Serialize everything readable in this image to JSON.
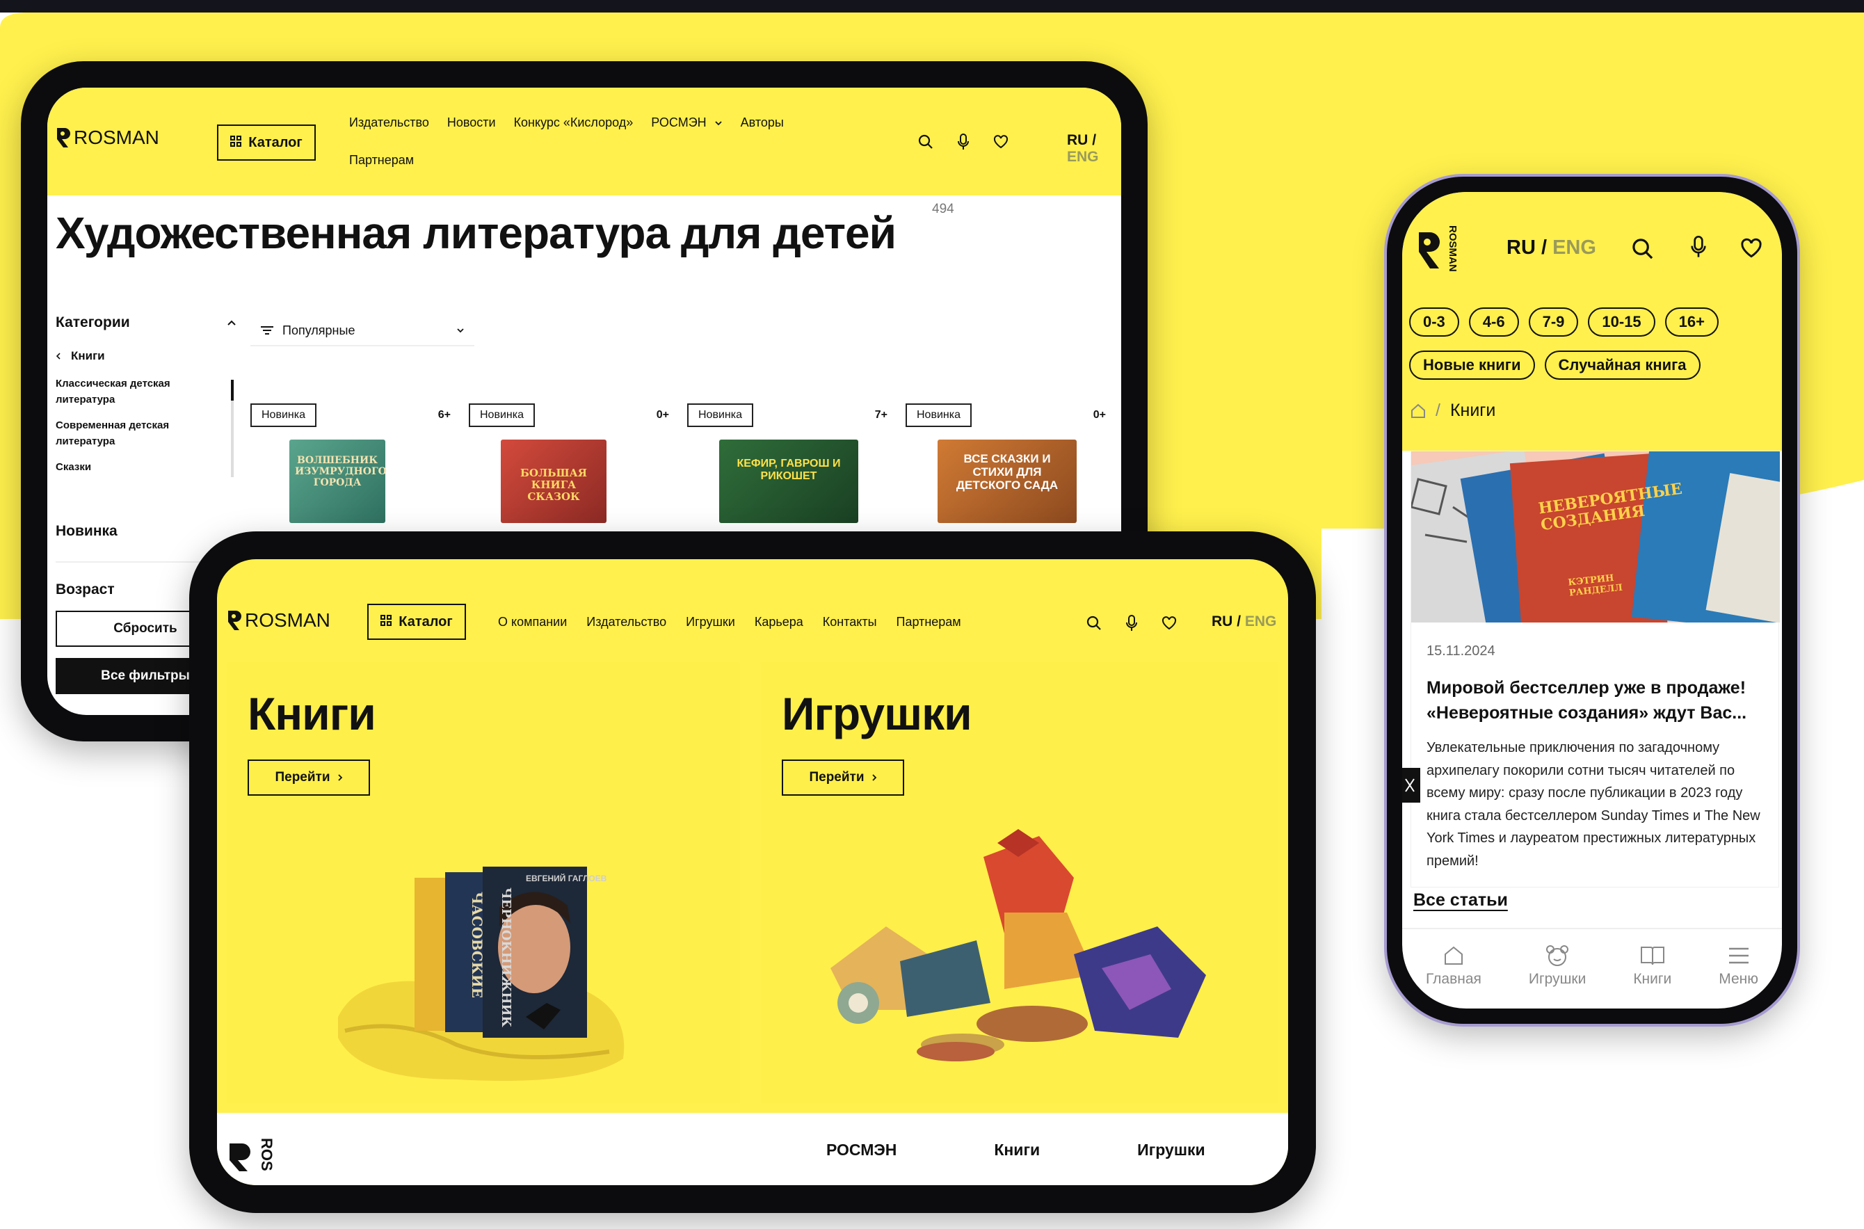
{
  "colors": {
    "accent_yellow": "#fff04d",
    "dark": "#111111",
    "muted_lang": "#9a9a5a"
  },
  "tablet_catalog": {
    "logo_text": "ROSMAN",
    "catalog_button": "Каталог",
    "nav": [
      "Издательство",
      "Новости",
      "Конкурс «Кислород»",
      "РОСМЭН",
      "Авторы",
      "Партнерам"
    ],
    "lang_ru": "RU",
    "lang_sep": "/",
    "lang_eng": "ENG",
    "page_title": "Художественная литература для детей",
    "count": "494",
    "sidebar": {
      "categories_title": "Категории",
      "back_item": "Книги",
      "items": [
        "Классическая детская литература",
        "Современная детская литература",
        "Сказки"
      ],
      "filter_new": "Новинка",
      "filter_age": "Возраст",
      "reset_button": "Сбросить",
      "all_filters_button": "Все фильтры"
    },
    "sort": {
      "selected": "Популярные"
    },
    "products": [
      {
        "badge": "Новинка",
        "age": "6+",
        "cover_text": "ВОЛШЕБНИК ИЗУМРУДНОГО ГОРОДА",
        "cover_color": "#3f8c78"
      },
      {
        "badge": "Новинка",
        "age": "0+",
        "cover_text": "БОЛЬШАЯ КНИГА СКАЗОК",
        "cover_color": "#c23a30"
      },
      {
        "badge": "Новинка",
        "age": "7+",
        "cover_text": "КЕФИР, ГАВРОШ И РИКОШЕТ",
        "cover_color": "#2f6d3a"
      },
      {
        "badge": "Новинка",
        "age": "0+",
        "cover_text": "ВСЕ СКАЗКИ И СТИХИ ДЛЯ ДЕТСКОГО САДА",
        "cover_color": "#c66a2b"
      }
    ]
  },
  "tablet_home": {
    "logo_text": "ROSMAN",
    "catalog_button": "Каталог",
    "nav": [
      "О компании",
      "Издательство",
      "Игрушки",
      "Карьера",
      "Контакты",
      "Партнерам"
    ],
    "lang_ru": "RU",
    "lang_sep": "/",
    "lang_eng": "ENG",
    "tiles": [
      {
        "title": "Книги",
        "button": "Перейти"
      },
      {
        "title": "Игрушки",
        "button": "Перейти"
      }
    ],
    "book_spines": [
      "ЧАСОВСКИЕ",
      "ЧЕРНОКНИЖНИК"
    ],
    "book_cover_author": "ЕВГЕНИЙ ГАГЛОЕВ",
    "footer": {
      "logo_text": "ROS",
      "links": [
        "РОСМЭН",
        "Книги",
        "Игрушки"
      ]
    }
  },
  "phone": {
    "logo_text": "ROSMAN",
    "lang_ru": "RU",
    "lang_sep": "/",
    "lang_eng": "ENG",
    "age_pills": [
      "0-3",
      "4-6",
      "7-9",
      "10-15",
      "16+"
    ],
    "tag_pills": [
      "Новые книги",
      "Случайная книга"
    ],
    "breadcrumb_sep": "/",
    "breadcrumb_current": "Книги",
    "article": {
      "date": "15.11.2024",
      "title": "Мировой бестселлер уже в продаже! «Невероятные создания» ждут Вас...",
      "body": "Увлекательные приключения по загадочному архипелагу покорили сотни тысяч читателей по всему миру: сразу после публикации в 2023 году книга стала бестселлером Sunday Times и The New York Times и лауреатом престижных литературных премий!",
      "image_texts": [
        "НЕВЕРОЯТНЫЕ СОЗДАНИЯ",
        "КЭТРИН РАНДЕЛЛ"
      ]
    },
    "all_articles": "Все статьи",
    "tabbar": [
      "Главная",
      "Игрушки",
      "Книги",
      "Меню"
    ]
  }
}
